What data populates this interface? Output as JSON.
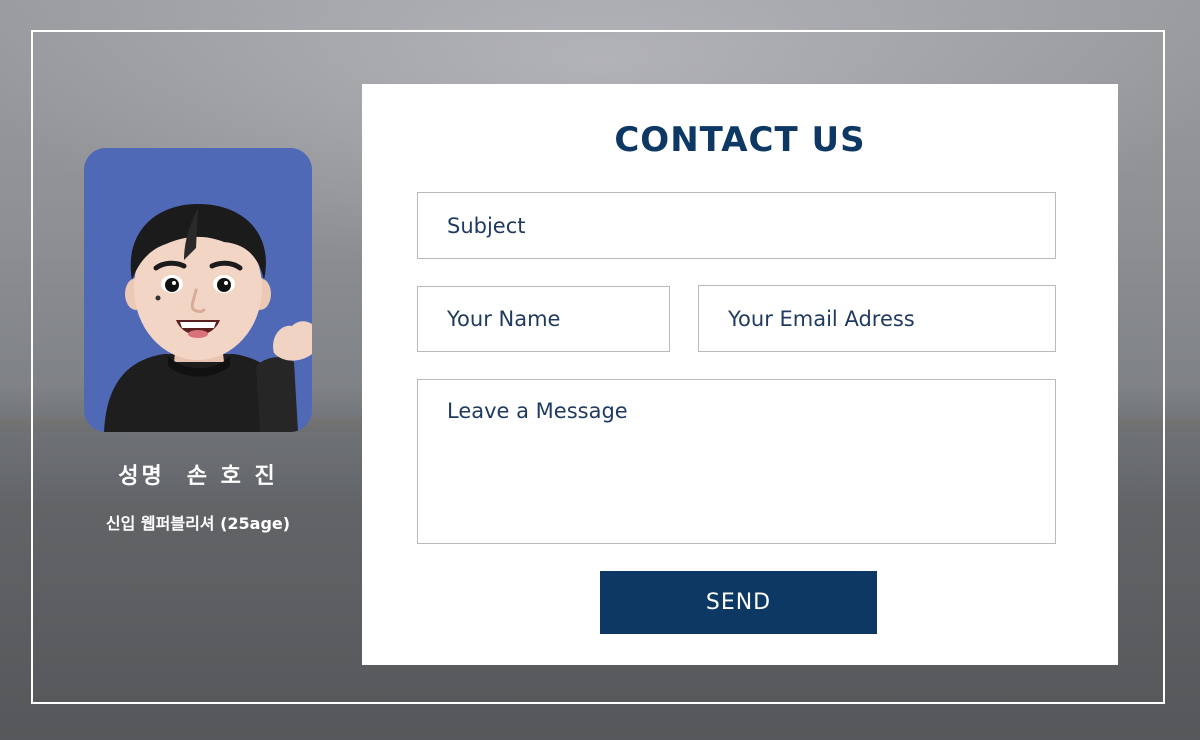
{
  "profile": {
    "label": "성명",
    "name": "손 호 진",
    "role": "신입 웹퍼블리셔 (25age)"
  },
  "contact": {
    "title": "CONTACT US",
    "subject_placeholder": "Subject",
    "name_placeholder": "Your Name",
    "email_placeholder": "Your Email Adress",
    "message_placeholder": "Leave a Message",
    "send_label": "SEND"
  },
  "colors": {
    "accent": "#0d3864",
    "avatar_background": "#5069b7"
  }
}
